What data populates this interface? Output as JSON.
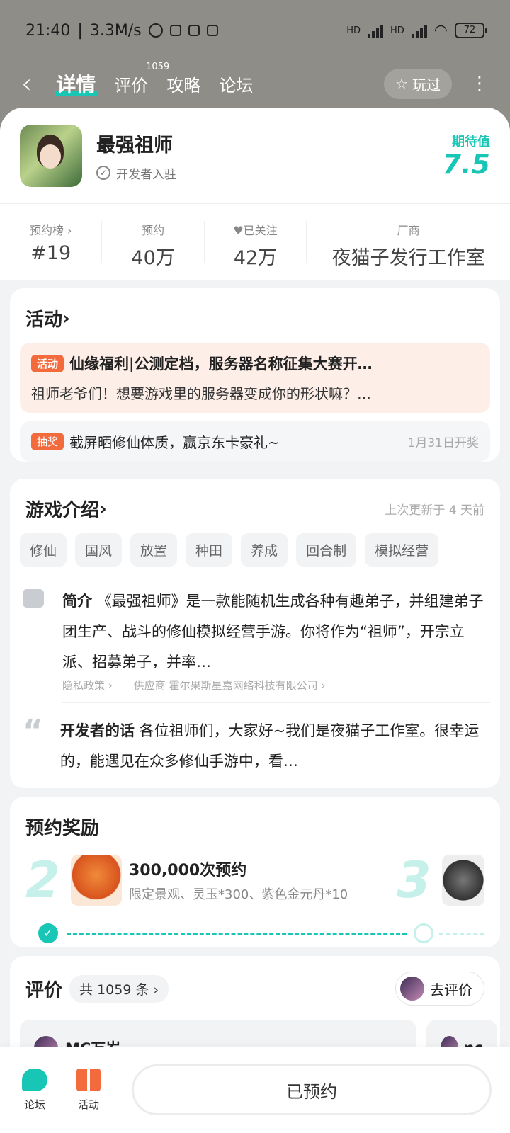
{
  "status": {
    "time": "21:40",
    "speed": "3.3M/s",
    "hd1": "HD",
    "hd2": "HD",
    "battery": "72"
  },
  "nav": {
    "tabs": [
      {
        "label": "详情"
      },
      {
        "label": "评价",
        "badge": "1059"
      },
      {
        "label": "攻略"
      },
      {
        "label": "论坛"
      }
    ],
    "played_label": "玩过"
  },
  "game": {
    "title": "最强祖师",
    "developer": "开发者入驻",
    "expect_label": "期待值",
    "expect_value": "7.5"
  },
  "stats": [
    {
      "label": "预约榜",
      "value": "#19"
    },
    {
      "label": "预约",
      "value": "40万"
    },
    {
      "label": "已关注",
      "value": "42万"
    },
    {
      "label": "厂商",
      "value": "夜猫子发行工作室"
    }
  ],
  "activity": {
    "title": "活动",
    "tag": "活动",
    "main_title": "仙缘福利|公测定档，服务器名称征集大赛开…",
    "main_desc": "祖师老爷们！想要游戏里的服务器变成你的形状嘛？…",
    "lottery_tag": "抽奖",
    "lottery_text": "截屏晒修仙体质，赢京东卡豪礼~",
    "lottery_date": "1月31日开奖"
  },
  "intro": {
    "title": "游戏介绍",
    "updated": "上次更新于 4 天前",
    "tags": [
      "修仙",
      "国风",
      "放置",
      "种田",
      "养成",
      "回合制",
      "模拟经营"
    ],
    "summary_label": "简介",
    "summary": "《最强祖师》是一款能随机生成各种有趣弟子，并组建弟子团生产、战斗的修仙模拟经营手游。你将作为“祖师”，开宗立派、招募弟子，并率…",
    "privacy": "隐私政策",
    "supplier": "供应商 霍尔果斯星嘉网络科技有限公司",
    "dev_label": "开发者的话",
    "dev_words": "各位祖师们，大家好~我们是夜猫子工作室。很幸运的，能遇见在众多修仙手游中，看…"
  },
  "rewards": {
    "title": "预约奖励",
    "items": [
      {
        "num": "2",
        "title": "300,000次预约",
        "desc": "限定景观、灵玉*300、紫色金元丹*10"
      },
      {
        "num": "3"
      }
    ],
    "progress_reached": 1
  },
  "reviews": {
    "title": "评价",
    "count": "共 1059 条",
    "go_label": "去评价",
    "items": [
      {
        "user": "MC万岁"
      },
      {
        "user": "nc"
      }
    ]
  },
  "bottom": {
    "forum": "论坛",
    "activity": "活动",
    "reserve": "已预约"
  }
}
